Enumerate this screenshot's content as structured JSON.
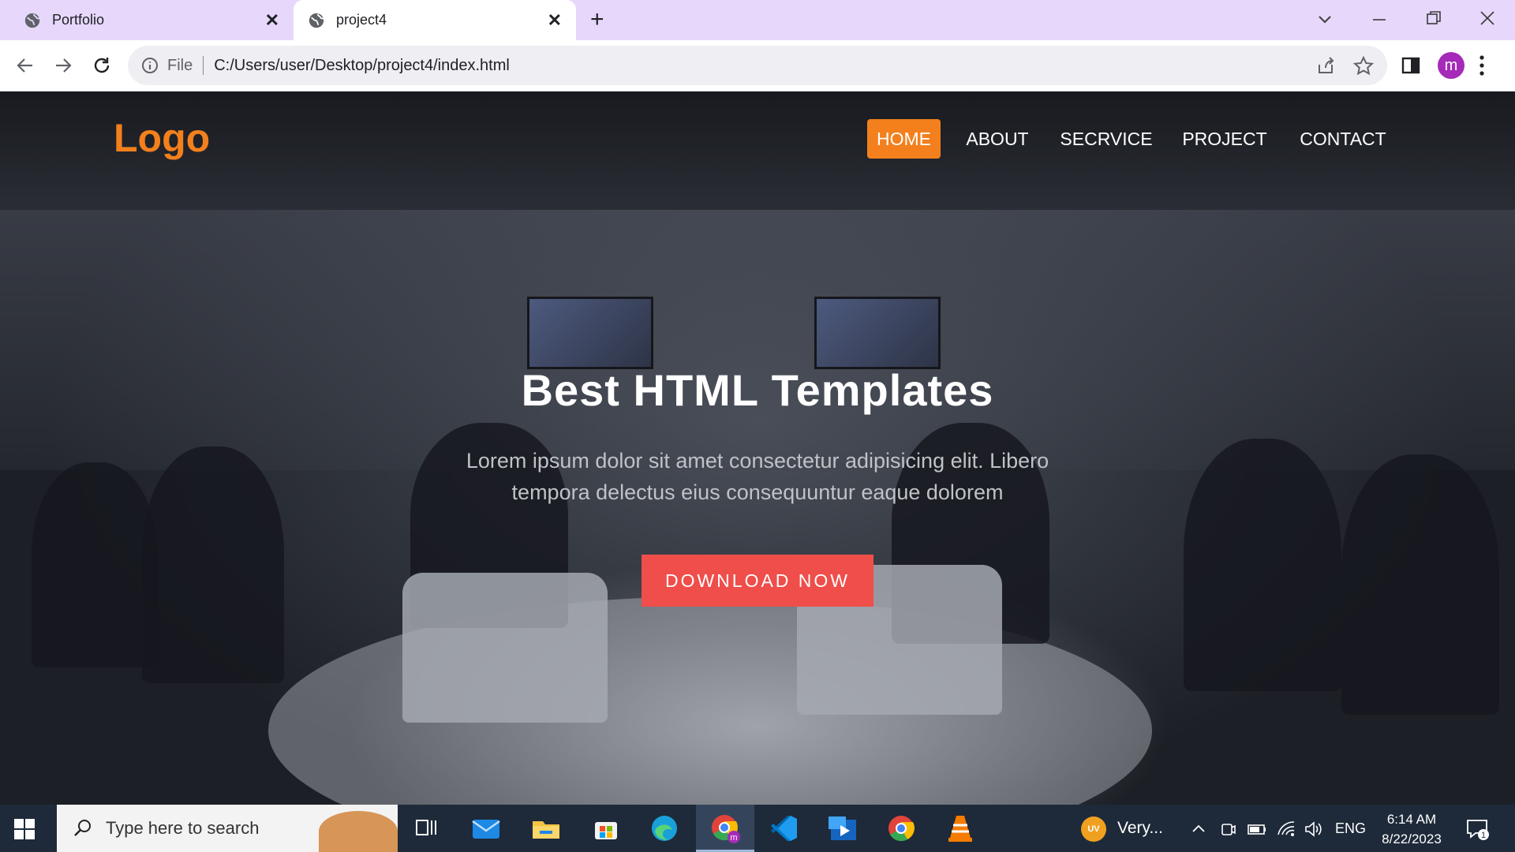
{
  "browser": {
    "tabs": [
      {
        "title": "Portfolio",
        "active": false
      },
      {
        "title": "project4",
        "active": true
      }
    ],
    "new_tab": "+",
    "address": {
      "scheme_label": "File",
      "url": "C:/Users/user/Desktop/project4/index.html"
    },
    "profile_initial": "m"
  },
  "site": {
    "logo": "Logo",
    "nav": [
      {
        "label": "HOME",
        "active": true
      },
      {
        "label": "ABOUT",
        "active": false
      },
      {
        "label": "SECRVICE",
        "active": false
      },
      {
        "label": "PROJECT",
        "active": false
      },
      {
        "label": "CONTACT",
        "active": false
      }
    ],
    "hero": {
      "title": "Best HTML Templates",
      "text": "Lorem ipsum dolor sit amet consectetur adipisicing elit. Libero tempora delectus eius consequuntur eaque dolorem",
      "button": "DOWNLOAD NOW"
    },
    "colors": {
      "accent": "#f3801c",
      "button": "#ef4e4a"
    }
  },
  "taskbar": {
    "search_placeholder": "Type here to search",
    "weather_badge": "UV",
    "weather_text": "Very...",
    "language": "ENG",
    "time": "6:14 AM",
    "date": "8/22/2023",
    "notification_count": "1"
  }
}
